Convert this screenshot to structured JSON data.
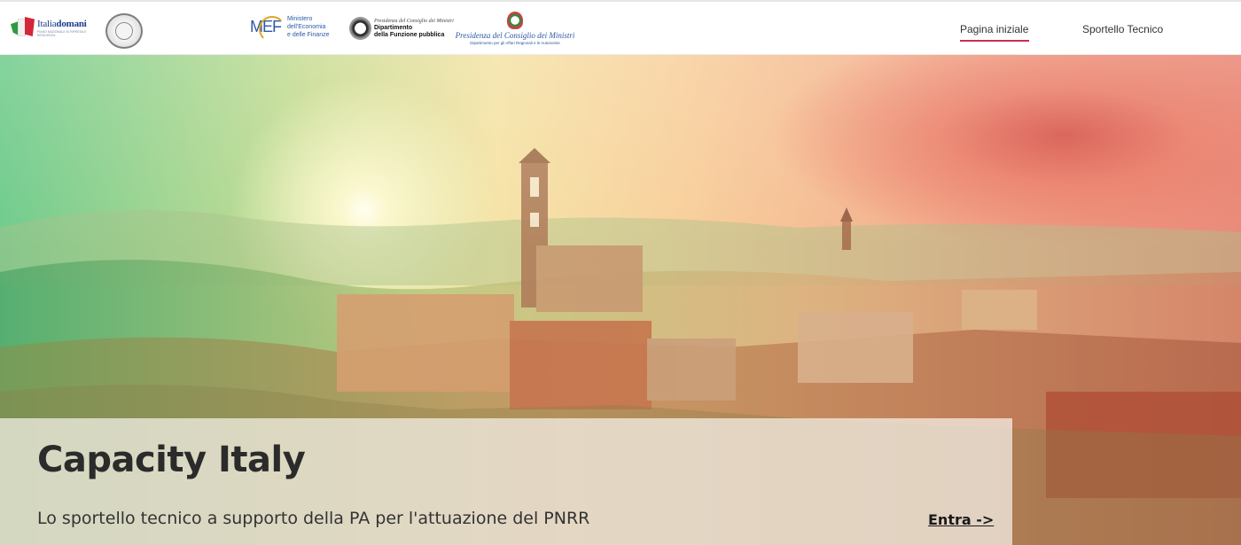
{
  "header": {
    "logos": {
      "italiadomani": {
        "brand_light": "Italia",
        "brand_bold": "domani",
        "subline": "PIANO NAZIONALE DI RIPRESA E RESILIENZA"
      },
      "mef": {
        "mark": "MEF",
        "line1": "Ministero",
        "line2": "dell'Economia",
        "line3": "e delle Finanze"
      },
      "funzione_pubblica": {
        "line1": "Presidenza del Consiglio dei Ministri",
        "line2": "Dipartimento",
        "line3": "della Funzione pubblica"
      },
      "presidenza": {
        "line1": "Presidenza del Consiglio dei Ministri",
        "line2": "Dipartimento per gli Affari Regionali e le Autonomie"
      }
    },
    "nav": {
      "home_label": "Pagina iniziale",
      "sportello_label": "Sportello Tecnico"
    }
  },
  "hero": {
    "title": "Capacity Italy",
    "subtitle": "Lo sportello tecnico a supporto della PA per l'attuazione del PNRR",
    "cta_label": "Entra ->"
  },
  "colors": {
    "accent_underline": "#c5314a",
    "logo_blue": "#2d5aa6"
  }
}
